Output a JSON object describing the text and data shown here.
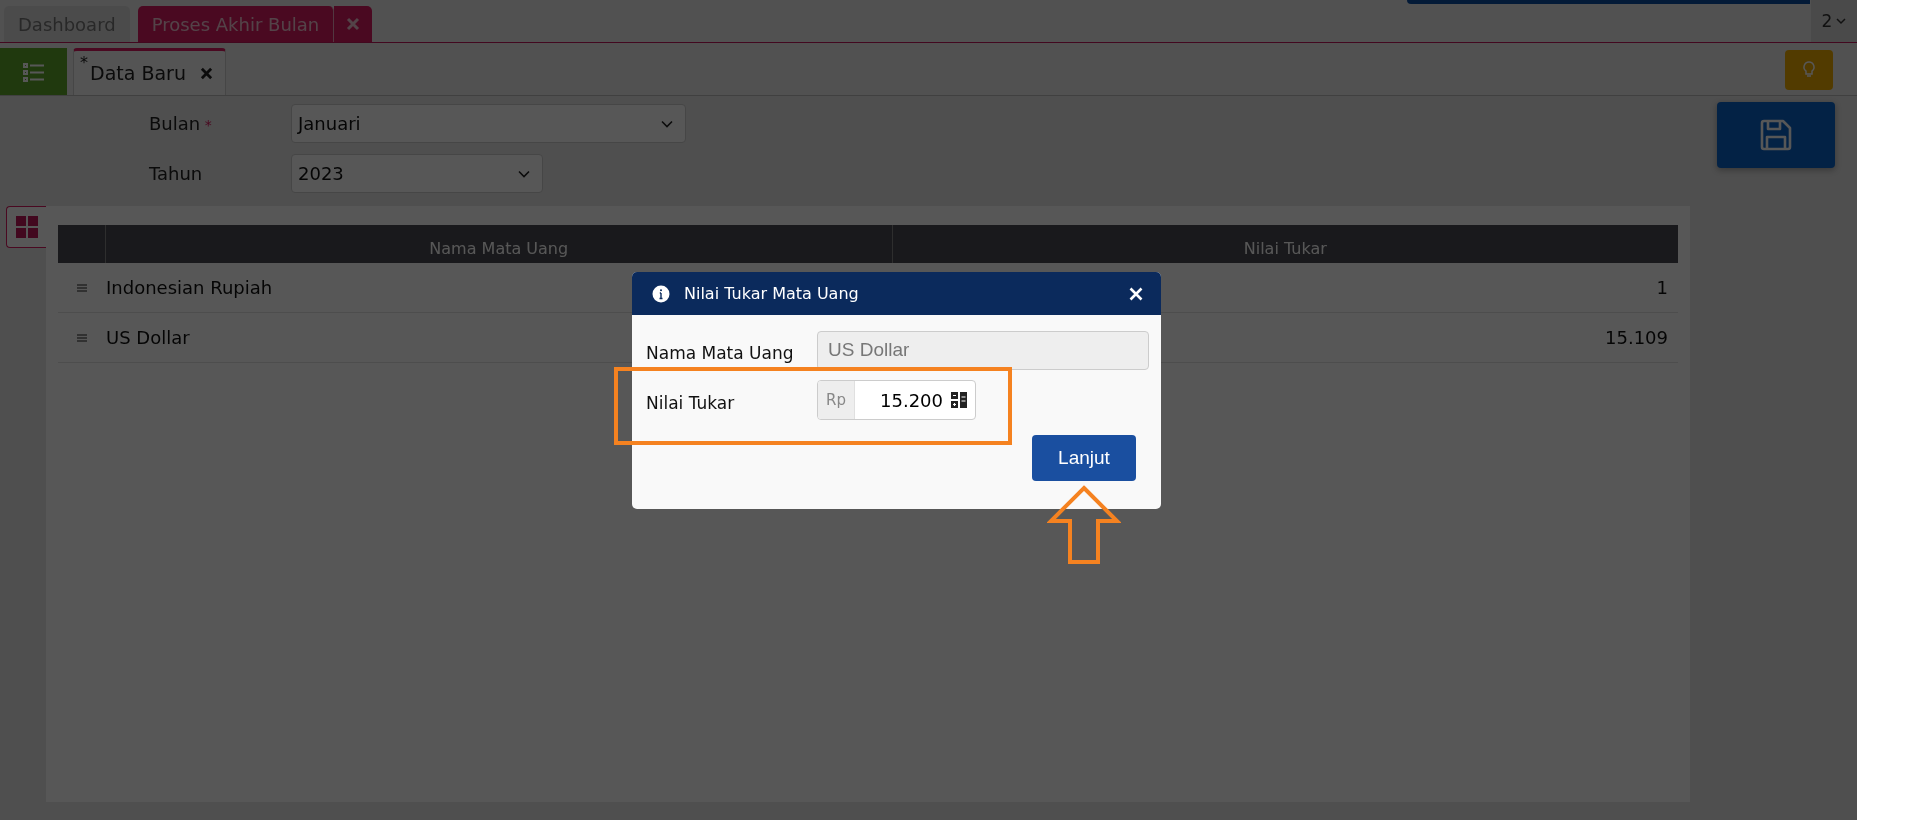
{
  "top_tabs": [
    {
      "label": "Dashboard",
      "selected": false,
      "closable": false
    },
    {
      "label": "Proses Akhir Bulan",
      "selected": true,
      "closable": true
    }
  ],
  "page_counter": "2",
  "sub_tabs": [
    {
      "prefix": "*",
      "label": "Data Baru"
    }
  ],
  "form": [
    {
      "label": "Bulan",
      "required_mark": "*",
      "value": "Januari"
    },
    {
      "label": "Tahun",
      "value": "2023"
    }
  ],
  "table": {
    "columns": [
      "Nama Mata Uang",
      "Nilai Tukar"
    ],
    "rows": [
      {
        "name": "Indonesian Rupiah",
        "rate": "1"
      },
      {
        "name": "US Dollar",
        "rate": "15.109"
      }
    ]
  },
  "dialog": {
    "title": "Nilai Tukar Mata Uang",
    "fields": [
      {
        "kind": "text",
        "label": "Nama Mata Uang",
        "value": "US Dollar",
        "disabled": true
      },
      {
        "kind": "number",
        "label": "Nilai Tukar",
        "prefix": "Rp",
        "value": "15.200",
        "disabled": false
      }
    ],
    "button": "Lanjut"
  }
}
